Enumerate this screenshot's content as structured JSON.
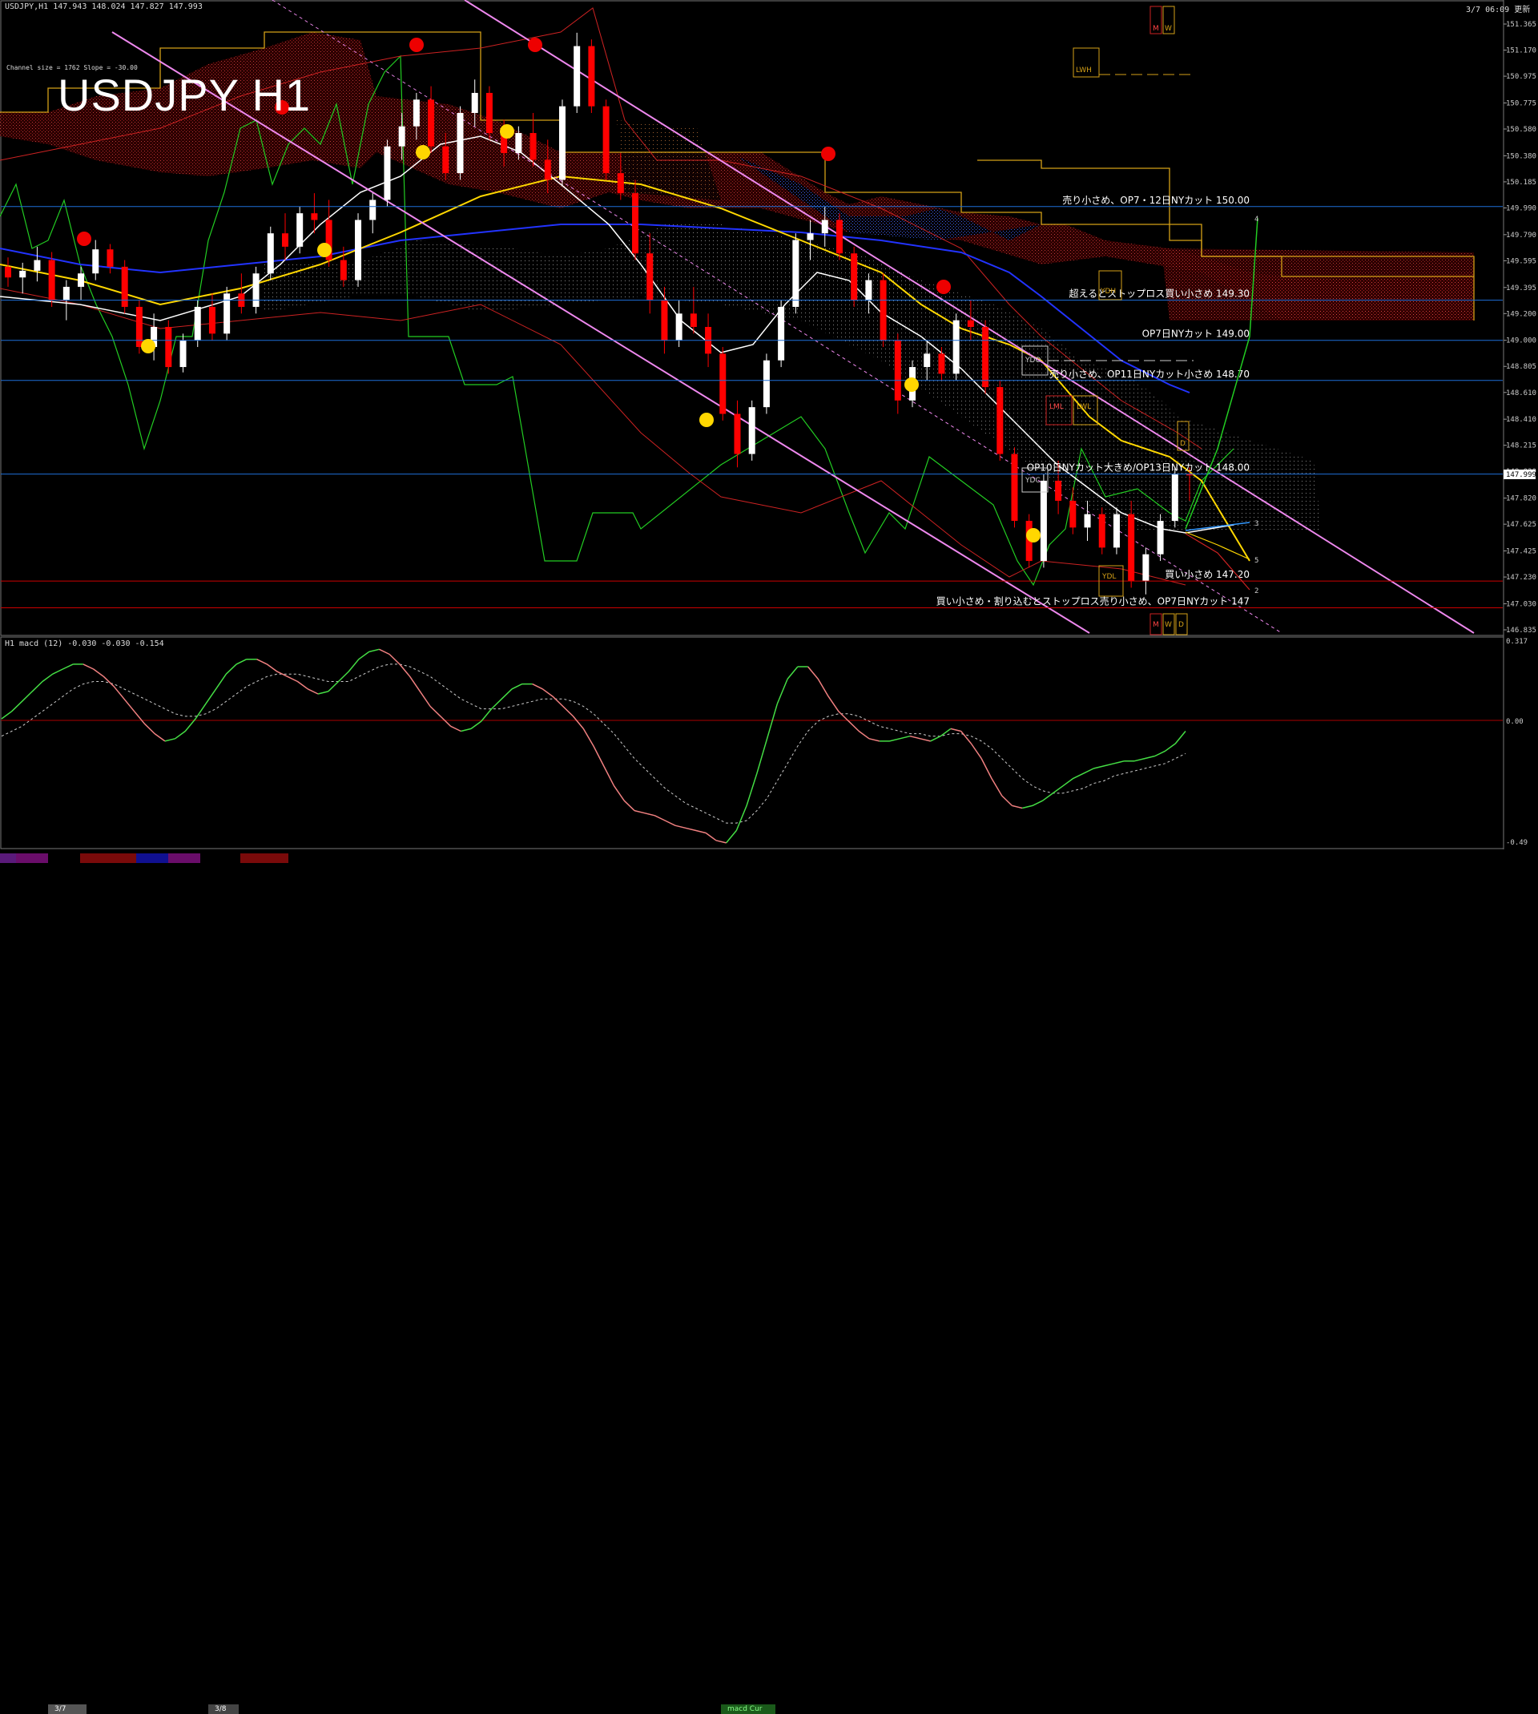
{
  "header": {
    "symbol_line": "USDJPY,H1  147.943 148.024 147.827 147.993",
    "channel_info": "Channel size = 1762 Slope = -30.00",
    "big_title": "USDJPY H1",
    "server_time": "3/7 06:09 更新"
  },
  "macd_header": "H1  macd (12) -0.030 -0.030 -0.154",
  "price_box": "147.999",
  "tabs": [
    "3/7",
    "3/8",
    "macd Cur"
  ],
  "colors": {
    "bull_candle": "#ffffff",
    "bear_candle": "#ff0000",
    "ma_fast": "#ffffff",
    "ma_mid": "#ffd700",
    "ma_slow": "#1e2fff",
    "channel": "#ee88ee",
    "hline_blue": "#1e6fd8",
    "hline_red": "#cc0000",
    "macd_up": "#44dd44",
    "macd_down": "#f08080",
    "lagging_span": "#22cc22"
  },
  "chart_data": {
    "type": "candlestick",
    "title": "USDJPY H1",
    "y_axis_ticks": [
      "151.365",
      "151.170",
      "150.975",
      "150.775",
      "150.580",
      "150.380",
      "150.185",
      "149.990",
      "149.790",
      "149.595",
      "149.395",
      "149.200",
      "149.000",
      "148.805",
      "148.610",
      "148.410",
      "148.215",
      "148.020",
      "147.820",
      "147.625",
      "147.425",
      "147.230",
      "147.030",
      "146.835"
    ],
    "ylim": [
      146.835,
      151.365
    ],
    "current_price": 147.999,
    "annotations": [
      {
        "text": "売り小さめ、OP7・12日NYカット 150.00",
        "price": 150.0
      },
      {
        "text": "超えるとストップロス買い小さめ 149.30",
        "price": 149.3
      },
      {
        "text": "OP7日NYカット 149.00",
        "price": 149.0
      },
      {
        "text": "売り小さめ、OP11日NYカット小さめ 148.70",
        "price": 148.7
      },
      {
        "text": "OP10日NYカット大きめ/OP13日NYカット 148.00",
        "price": 148.0
      },
      {
        "text": "買い小さめ 147.20",
        "price": 147.2
      },
      {
        "text": "買い小さめ・割り込むとストップロス売り小さめ、OP7日NYカット 147",
        "price": 147.0
      }
    ],
    "level_boxes": [
      "LWH",
      "YDH",
      "YDO",
      "LML",
      "LWL",
      "YDC",
      "YDL",
      "M",
      "W",
      "D"
    ],
    "projection_labels": [
      "4",
      "3",
      "5",
      "2"
    ],
    "candles": [
      [
        149.55,
        149.62,
        149.4,
        149.47
      ],
      [
        149.47,
        149.58,
        149.35,
        149.52
      ],
      [
        149.52,
        149.7,
        149.44,
        149.6
      ],
      [
        149.6,
        149.66,
        149.25,
        149.3
      ],
      [
        149.3,
        149.45,
        149.15,
        149.4
      ],
      [
        149.4,
        149.55,
        149.3,
        149.5
      ],
      [
        149.5,
        149.75,
        149.45,
        149.68
      ],
      [
        149.68,
        149.72,
        149.5,
        149.55
      ],
      [
        149.55,
        149.6,
        149.2,
        149.25
      ],
      [
        149.25,
        149.3,
        148.9,
        148.95
      ],
      [
        148.95,
        149.2,
        148.85,
        149.1
      ],
      [
        149.1,
        149.15,
        148.75,
        148.8
      ],
      [
        148.8,
        149.05,
        148.76,
        149.0
      ],
      [
        149.0,
        149.3,
        148.95,
        149.25
      ],
      [
        149.25,
        149.35,
        149.0,
        149.05
      ],
      [
        149.05,
        149.4,
        149.0,
        149.35
      ],
      [
        149.35,
        149.5,
        149.2,
        149.25
      ],
      [
        149.25,
        149.55,
        149.2,
        149.5
      ],
      [
        149.5,
        149.85,
        149.45,
        149.8
      ],
      [
        149.8,
        149.95,
        149.6,
        149.7
      ],
      [
        149.7,
        150.0,
        149.65,
        149.95
      ],
      [
        149.95,
        150.1,
        149.8,
        149.9
      ],
      [
        149.9,
        150.05,
        149.55,
        149.6
      ],
      [
        149.6,
        149.7,
        149.4,
        149.45
      ],
      [
        149.45,
        149.95,
        149.4,
        149.9
      ],
      [
        149.9,
        150.1,
        149.8,
        150.05
      ],
      [
        150.05,
        150.5,
        150.0,
        150.45
      ],
      [
        150.45,
        150.7,
        150.35,
        150.6
      ],
      [
        150.6,
        150.85,
        150.5,
        150.8
      ],
      [
        150.8,
        150.9,
        150.4,
        150.45
      ],
      [
        150.45,
        150.55,
        150.2,
        150.25
      ],
      [
        150.25,
        150.75,
        150.2,
        150.7
      ],
      [
        150.7,
        150.95,
        150.6,
        150.85
      ],
      [
        150.85,
        150.9,
        150.5,
        150.55
      ],
      [
        150.55,
        150.65,
        150.3,
        150.4
      ],
      [
        150.4,
        150.6,
        150.35,
        150.55
      ],
      [
        150.55,
        150.7,
        150.3,
        150.35
      ],
      [
        150.35,
        150.5,
        150.1,
        150.2
      ],
      [
        150.2,
        150.8,
        150.15,
        150.75
      ],
      [
        150.75,
        151.3,
        150.7,
        151.2
      ],
      [
        151.2,
        151.25,
        150.7,
        150.75
      ],
      [
        150.75,
        150.8,
        150.2,
        150.25
      ],
      [
        150.25,
        150.4,
        150.05,
        150.1
      ],
      [
        150.1,
        150.2,
        149.6,
        149.65
      ],
      [
        149.65,
        149.8,
        149.2,
        149.3
      ],
      [
        149.3,
        149.4,
        148.9,
        149.0
      ],
      [
        149.0,
        149.3,
        148.95,
        149.2
      ],
      [
        149.2,
        149.4,
        149.05,
        149.1
      ],
      [
        149.1,
        149.2,
        148.8,
        148.9
      ],
      [
        148.9,
        148.95,
        148.4,
        148.45
      ],
      [
        148.45,
        148.55,
        148.05,
        148.15
      ],
      [
        148.15,
        148.55,
        148.1,
        148.5
      ],
      [
        148.5,
        148.9,
        148.45,
        148.85
      ],
      [
        148.85,
        149.3,
        148.8,
        149.25
      ],
      [
        149.25,
        149.8,
        149.2,
        149.75
      ],
      [
        149.75,
        149.9,
        149.6,
        149.8
      ],
      [
        149.8,
        150.0,
        149.7,
        149.9
      ],
      [
        149.9,
        149.95,
        149.6,
        149.65
      ],
      [
        149.65,
        149.7,
        149.25,
        149.3
      ],
      [
        149.3,
        149.5,
        149.2,
        149.45
      ],
      [
        149.45,
        149.5,
        148.95,
        149.0
      ],
      [
        149.0,
        149.05,
        148.45,
        148.55
      ],
      [
        148.55,
        148.85,
        148.5,
        148.8
      ],
      [
        148.8,
        149.0,
        148.7,
        148.9
      ],
      [
        148.9,
        148.95,
        148.7,
        148.75
      ],
      [
        148.75,
        149.2,
        148.7,
        149.15
      ],
      [
        149.15,
        149.3,
        149.0,
        149.1
      ],
      [
        149.1,
        149.15,
        148.6,
        148.65
      ],
      [
        148.65,
        148.7,
        148.1,
        148.15
      ],
      [
        148.15,
        148.2,
        147.6,
        147.65
      ],
      [
        147.65,
        147.7,
        147.3,
        147.35
      ],
      [
        147.35,
        148.0,
        147.3,
        147.95
      ],
      [
        147.95,
        148.1,
        147.7,
        147.8
      ],
      [
        147.8,
        147.9,
        147.55,
        147.6
      ],
      [
        147.6,
        147.8,
        147.5,
        147.7
      ],
      [
        147.7,
        147.75,
        147.4,
        147.45
      ],
      [
        147.45,
        147.75,
        147.4,
        147.7
      ],
      [
        147.7,
        147.8,
        147.15,
        147.2
      ],
      [
        147.2,
        147.45,
        147.1,
        147.4
      ],
      [
        147.4,
        147.7,
        147.35,
        147.65
      ],
      [
        147.65,
        148.05,
        147.6,
        148.0
      ],
      [
        148.0,
        148.05,
        147.8,
        147.99
      ]
    ]
  },
  "macd_chart": {
    "type": "line",
    "y_axis_ticks": [
      "0.317",
      "0.00",
      "-0.49"
    ],
    "ylim": [
      -0.49,
      0.317
    ],
    "macd": [
      0.02,
      0.05,
      0.09,
      0.13,
      0.17,
      0.2,
      0.22,
      0.24,
      0.24,
      0.22,
      0.19,
      0.15,
      0.1,
      0.05,
      0.0,
      -0.04,
      -0.07,
      -0.06,
      -0.03,
      0.02,
      0.08,
      0.14,
      0.2,
      0.24,
      0.26,
      0.26,
      0.24,
      0.21,
      0.19,
      0.17,
      0.14,
      0.12,
      0.13,
      0.17,
      0.21,
      0.26,
      0.29,
      0.3,
      0.28,
      0.24,
      0.19,
      0.13,
      0.07,
      0.03,
      -0.01,
      -0.03,
      -0.02,
      0.01,
      0.06,
      0.1,
      0.14,
      0.16,
      0.16,
      0.14,
      0.11,
      0.07,
      0.03,
      -0.02,
      -0.09,
      -0.17,
      -0.25,
      -0.31,
      -0.35,
      -0.36,
      -0.37,
      -0.39,
      -0.41,
      -0.42,
      -0.43,
      -0.44,
      -0.47,
      -0.48,
      -0.43,
      -0.33,
      -0.2,
      -0.06,
      0.08,
      0.18,
      0.23,
      0.23,
      0.18,
      0.11,
      0.05,
      0.01,
      -0.03,
      -0.06,
      -0.07,
      -0.07,
      -0.06,
      -0.05,
      -0.06,
      -0.07,
      -0.05,
      -0.02,
      -0.03,
      -0.08,
      -0.14,
      -0.22,
      -0.29,
      -0.33,
      -0.34,
      -0.33,
      -0.31,
      -0.28,
      -0.25,
      -0.22,
      -0.2,
      -0.18,
      -0.17,
      -0.16,
      -0.15,
      -0.15,
      -0.14,
      -0.13,
      -0.11,
      -0.08,
      -0.03
    ],
    "signal": [
      -0.05,
      -0.03,
      -0.01,
      0.02,
      0.05,
      0.08,
      0.11,
      0.14,
      0.16,
      0.17,
      0.17,
      0.16,
      0.14,
      0.12,
      0.1,
      0.08,
      0.06,
      0.04,
      0.03,
      0.03,
      0.04,
      0.06,
      0.09,
      0.12,
      0.15,
      0.17,
      0.19,
      0.2,
      0.2,
      0.2,
      0.19,
      0.18,
      0.17,
      0.17,
      0.17,
      0.19,
      0.21,
      0.23,
      0.24,
      0.24,
      0.23,
      0.21,
      0.19,
      0.16,
      0.13,
      0.1,
      0.08,
      0.06,
      0.06,
      0.06,
      0.07,
      0.08,
      0.09,
      0.1,
      0.1,
      0.1,
      0.09,
      0.07,
      0.04,
      0.0,
      -0.04,
      -0.09,
      -0.14,
      -0.18,
      -0.22,
      -0.26,
      -0.29,
      -0.32,
      -0.34,
      -0.36,
      -0.38,
      -0.4,
      -0.4,
      -0.39,
      -0.35,
      -0.3,
      -0.23,
      -0.16,
      -0.09,
      -0.03,
      0.01,
      0.03,
      0.04,
      0.04,
      0.03,
      0.01,
      -0.01,
      -0.02,
      -0.03,
      -0.04,
      -0.04,
      -0.05,
      -0.05,
      -0.04,
      -0.04,
      -0.05,
      -0.07,
      -0.1,
      -0.14,
      -0.18,
      -0.22,
      -0.25,
      -0.27,
      -0.28,
      -0.28,
      -0.27,
      -0.26,
      -0.24,
      -0.23,
      -0.21,
      -0.2,
      -0.19,
      -0.18,
      -0.17,
      -0.16,
      -0.14,
      -0.12
    ]
  }
}
